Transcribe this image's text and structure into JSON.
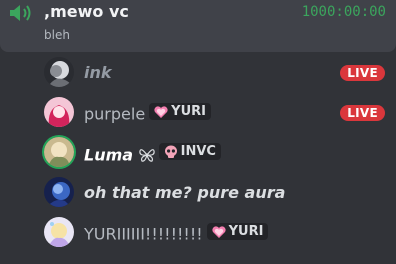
{
  "channel": {
    "name": ",mewo vc",
    "timer": "1000:00:00",
    "status": "bleh",
    "icon": "speaker-icon"
  },
  "members": [
    {
      "name": "ink",
      "live": "LIVE"
    },
    {
      "name": "purpele",
      "tag": "YURI",
      "tag_icon": "heart-icon",
      "live": "LIVE"
    },
    {
      "name": "Luma",
      "badge": "butterfly-icon",
      "tag": "INVC",
      "tag_icon": "skull-icon"
    },
    {
      "name": "oh that me? pure aura"
    },
    {
      "name": "YURIIIIII!!!!!!!!!",
      "tag": "YURI",
      "tag_icon": "heart-icon"
    }
  ],
  "colors": {
    "background": "#313338",
    "channel_bg": "#404249",
    "live": "#da373c",
    "timer": "#3ba55d",
    "tag_bg": "#232428"
  }
}
